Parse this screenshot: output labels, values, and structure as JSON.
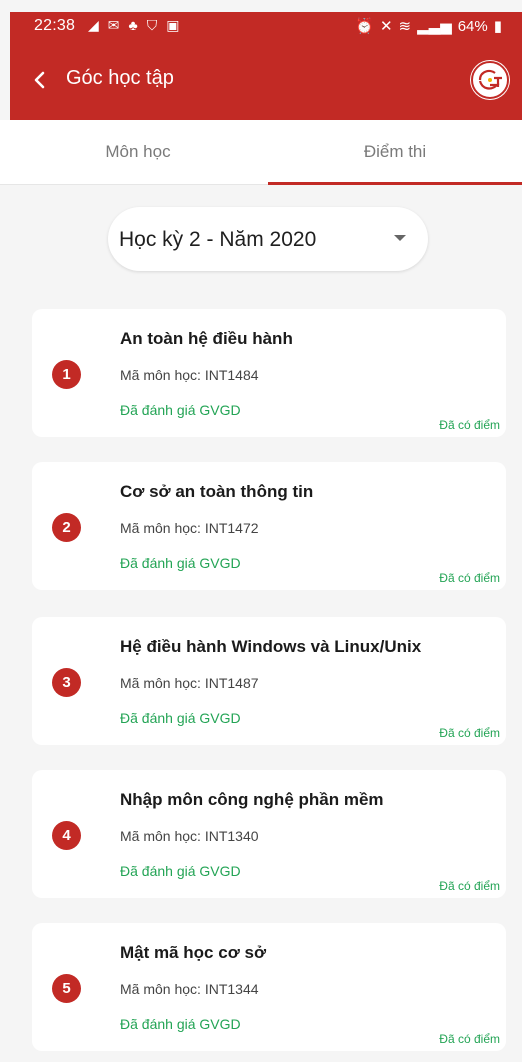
{
  "status_bar": {
    "time": "22:38",
    "battery": "64%",
    "left_icons": [
      "telegram-icon",
      "gmail-icon",
      "app-icon",
      "shield-icon",
      "image-icon"
    ],
    "right_icons": [
      "alarm-icon",
      "mute-icon",
      "wifi-icon",
      "signal-icon",
      "battery-icon"
    ]
  },
  "app_bar": {
    "title": "Góc học tập"
  },
  "tabs": [
    {
      "label": "Môn học",
      "active": false
    },
    {
      "label": "Điểm thi",
      "active": true
    }
  ],
  "semester": {
    "label": "Học kỳ 2 - Năm 2020"
  },
  "courses": [
    {
      "number": "1",
      "name": "An toàn hệ điều hành",
      "code": "Mã môn học: INT1484",
      "evaluation": "Đã đánh giá GVGD",
      "score_status": "Đã có điểm"
    },
    {
      "number": "2",
      "name": "Cơ sở an toàn thông tin",
      "code": "Mã môn học: INT1472",
      "evaluation": "Đã đánh giá GVGD",
      "score_status": "Đã có điểm"
    },
    {
      "number": "3",
      "name": "Hệ điều hành Windows và Linux/Unix",
      "code": "Mã môn học: INT1487",
      "evaluation": "Đã đánh giá GVGD",
      "score_status": "Đã có điểm"
    },
    {
      "number": "4",
      "name": "Nhập môn công nghệ phần mềm",
      "code": "Mã môn học: INT1340",
      "evaluation": "Đã đánh giá GVGD",
      "score_status": "Đã có điểm"
    },
    {
      "number": "5",
      "name": "Mật mã học cơ sở",
      "code": "Mã môn học: INT1344",
      "evaluation": "Đã đánh giá GVGD",
      "score_status": "Đã có điểm"
    }
  ],
  "colors": {
    "primary": "#c22a25",
    "success": "#23a455",
    "background": "#f5f5f5"
  }
}
